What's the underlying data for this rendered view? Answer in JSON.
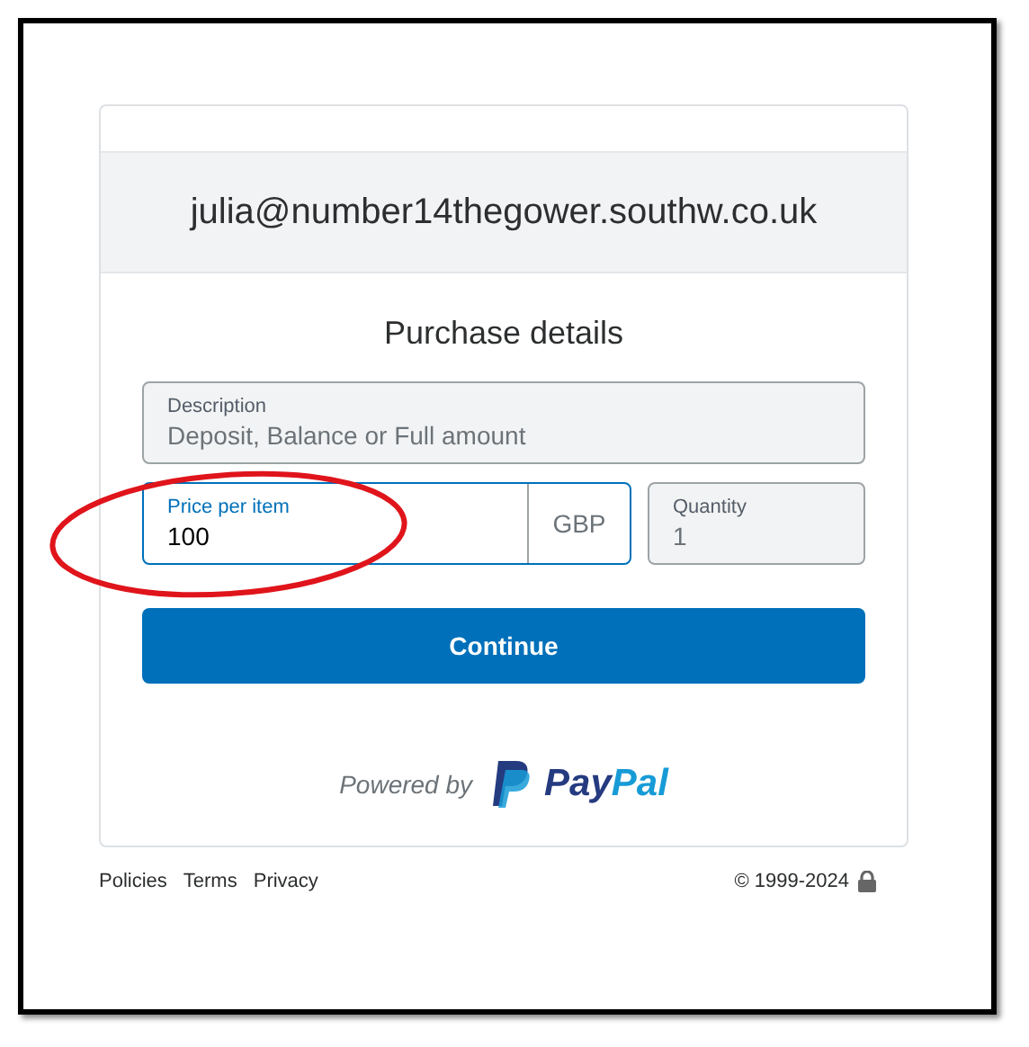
{
  "account": {
    "email": "julia@number14thegower.southw.co.uk"
  },
  "form": {
    "title": "Purchase details",
    "description": {
      "label": "Description",
      "placeholder": "Deposit, Balance or Full amount",
      "disabled": true
    },
    "price": {
      "label": "Price per item",
      "value": "100",
      "currency": "GBP",
      "focused": true,
      "disabled": false
    },
    "quantity": {
      "label": "Quantity",
      "value": "1",
      "disabled": true
    },
    "button": "Continue"
  },
  "powered_by": {
    "text": "Powered by",
    "brand_parts": [
      "Pay",
      "Pal"
    ]
  },
  "footer": {
    "links": [
      "Policies",
      "Terms",
      "Privacy"
    ],
    "copyright": "© 1999-2024"
  }
}
